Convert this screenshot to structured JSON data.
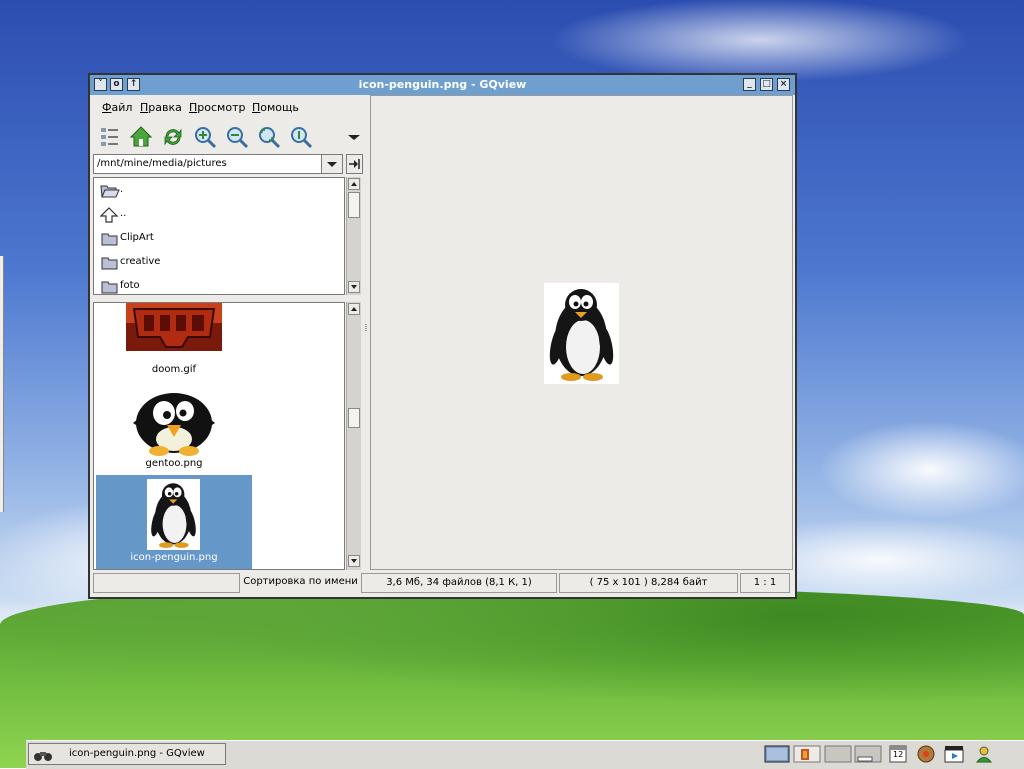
{
  "window": {
    "title": "icon-penguin.png - GQview"
  },
  "menu": {
    "file_ul": "Ф",
    "file_rest": "айл",
    "edit_ul": "П",
    "edit_rest": "равка",
    "view_ul": "П",
    "view_rest": "росмотр",
    "help_ul": "П",
    "help_rest": "омощь"
  },
  "toolbar": {
    "icons": [
      "thumbnails-toggle-icon",
      "home-icon",
      "refresh-icon",
      "zoom-in-icon",
      "zoom-out-icon",
      "zoom-fit-icon",
      "zoom-1to1-icon",
      "overflow-arrow-icon"
    ]
  },
  "path": {
    "value": "/mnt/mine/media/pictures"
  },
  "dir_list": {
    "items": [
      {
        "label": ".",
        "icon": "open-folder-icon"
      },
      {
        "label": "..",
        "icon": "up-arrow-icon"
      },
      {
        "label": "ClipArt",
        "icon": "folder-icon"
      },
      {
        "label": "creative",
        "icon": "folder-icon"
      },
      {
        "label": "foto",
        "icon": "folder-icon"
      }
    ]
  },
  "thumbnails": {
    "items": [
      {
        "name": "doom.gif",
        "selected": false
      },
      {
        "name": "gentoo.png",
        "selected": false
      },
      {
        "name": "icon-penguin.png",
        "selected": true
      }
    ]
  },
  "status": {
    "sort": "Сортировка по имени",
    "summary": "3,6 Мб, 34 файлов (8,1 К, 1)",
    "image_info": "( 75 x 101 ) 8,284 байт",
    "zoom": "1 : 1"
  },
  "taskbar": {
    "task_label": "icon-penguin.png - GQview",
    "clock_day": "12"
  },
  "colors": {
    "titlebar": "#6f9fcf",
    "selection": "#6598c9"
  }
}
